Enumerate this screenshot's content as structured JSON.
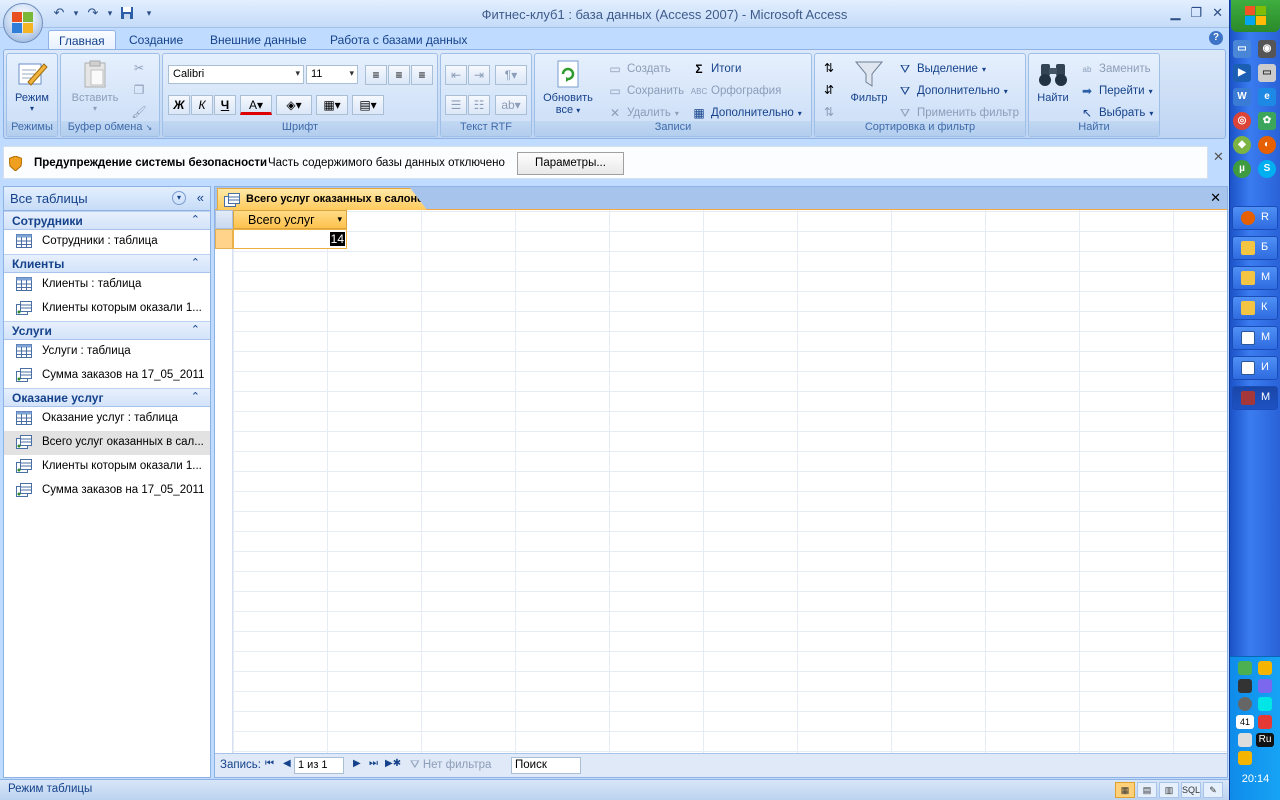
{
  "window": {
    "title": "Фитнес-клуб1 : база данных (Access 2007) - Microsoft Access"
  },
  "ribbon_tabs": [
    "Главная",
    "Создание",
    "Внешние данные",
    "Работа с базами данных"
  ],
  "ribbon": {
    "groups": {
      "modes": "Режимы",
      "clipboard": "Буфер обмена",
      "font": "Шрифт",
      "rtf": "Текст RTF",
      "records": "Записи",
      "sort_filter": "Сортировка и фильтр",
      "find": "Найти"
    },
    "view_label": "Режим",
    "paste_label": "Вставить",
    "font_name": "Calibri",
    "font_size": "11",
    "bold": "Ж",
    "italic": "К",
    "underline": "Ч",
    "refresh_line1": "Обновить",
    "refresh_line2": "все",
    "new": "Создать",
    "save": "Сохранить",
    "delete": "Удалить",
    "totals": "Итоги",
    "spelling": "Орфография",
    "more": "Дополнительно",
    "filter": "Фильтр",
    "selection": "Выделение",
    "advanced": "Дополнительно",
    "toggle_filter": "Применить фильтр",
    "find": "Найти",
    "replace": "Заменить",
    "goto": "Перейти",
    "select": "Выбрать"
  },
  "security_bar": {
    "title": "Предупреждение системы безопасности",
    "message": "Часть содержимого базы данных отключено",
    "button": "Параметры..."
  },
  "nav_pane": {
    "header": "Все таблицы",
    "groups": [
      {
        "name": "Сотрудники",
        "items": [
          {
            "label": "Сотрудники : таблица",
            "type": "table"
          }
        ]
      },
      {
        "name": "Клиенты",
        "items": [
          {
            "label": "Клиенты : таблица",
            "type": "table"
          },
          {
            "label": "Клиенты которым оказали 1...",
            "type": "query"
          }
        ]
      },
      {
        "name": "Услуги",
        "items": [
          {
            "label": "Услуги : таблица",
            "type": "table"
          },
          {
            "label": "Сумма заказов на 17_05_2011",
            "type": "query"
          }
        ]
      },
      {
        "name": "Оказание услуг",
        "items": [
          {
            "label": "Оказание услуг : таблица",
            "type": "table"
          },
          {
            "label": "Всего услуг оказанных в сал...",
            "type": "query"
          },
          {
            "label": "Клиенты которым оказали 1...",
            "type": "query"
          },
          {
            "label": "Сумма заказов на 17_05_2011",
            "type": "query"
          }
        ]
      }
    ]
  },
  "document": {
    "tab_title": "Всего услуг оказанных в салоне",
    "column_header": "Всего услуг",
    "cell_value": "14"
  },
  "record_nav": {
    "label": "Запись:",
    "position": "1 из 1",
    "no_filter": "Нет фильтра",
    "search": "Поиск"
  },
  "status_bar": {
    "mode": "Режим таблицы",
    "sql": "SQL"
  },
  "taskbar": {
    "buttons": [
      "R",
      "Б",
      "М",
      "К",
      "М",
      "И",
      "М"
    ],
    "lang": "Ru",
    "tray_number": "41",
    "clock": "20:14"
  }
}
